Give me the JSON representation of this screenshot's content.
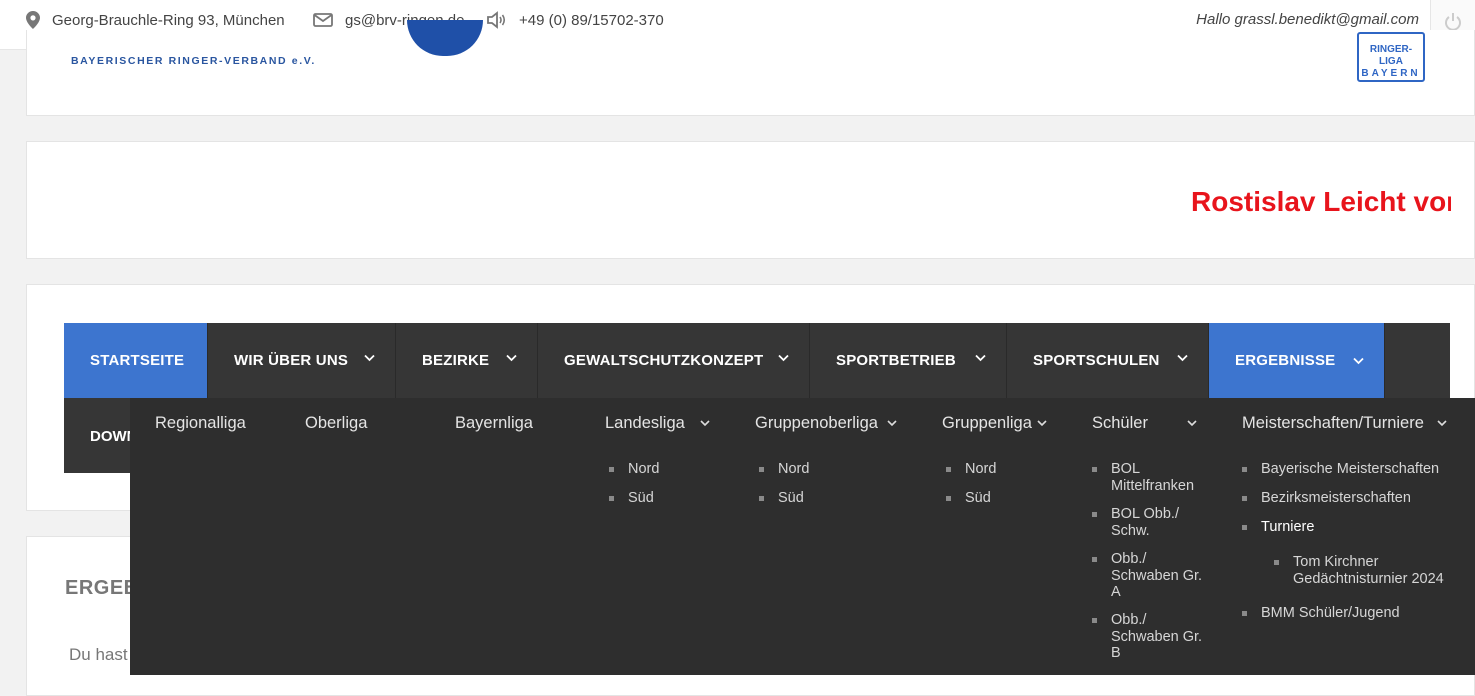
{
  "topbar": {
    "address": "Georg-Brauchle-Ring 93, München",
    "email": "gs@brv-ringen.de",
    "phone": "+49 (0) 89/15702-370",
    "greeting": "Hallo grassl.benedikt@gmail.com"
  },
  "header": {
    "logo_text": "BAYERISCHER RINGER-VERBAND e.V.",
    "liga_logo_line1": "RINGER-LIGA",
    "liga_logo_line2": "BAYERN"
  },
  "ticker": {
    "text": "Rostislav Leicht von"
  },
  "nav": {
    "items": [
      {
        "label": "STARTSEITE"
      },
      {
        "label": "WIR ÜBER UNS"
      },
      {
        "label": "BEZIRKE"
      },
      {
        "label": "GEWALTSCHUTZKONZEPT"
      },
      {
        "label": "SPORTBETRIEB"
      },
      {
        "label": "SPORTSCHULEN"
      },
      {
        "label": "ERGEBNISSE"
      }
    ],
    "row2_label": "DOWN"
  },
  "mega": {
    "columns": [
      {
        "head": "Regionalliga",
        "items": []
      },
      {
        "head": "Oberliga",
        "items": []
      },
      {
        "head": "Bayernliga",
        "items": []
      },
      {
        "head": "Landesliga",
        "items": [
          "Nord",
          "Süd"
        ]
      },
      {
        "head": "Gruppenoberliga",
        "items": [
          "Nord",
          "Süd"
        ]
      },
      {
        "head": "Gruppenliga",
        "items": [
          "Nord",
          "Süd"
        ]
      },
      {
        "head": "Schüler",
        "items": [
          "BOL Mittelfranken",
          "BOL Obb./ Schw.",
          "Obb./ Schwaben Gr. A",
          "Obb./ Schwaben Gr. B"
        ]
      },
      {
        "head": "Meisterschaften/Turniere",
        "items": [
          "Bayerische Meisterschaften",
          "Bezirksmeisterschaften",
          "Turniere",
          "BMM Schüler/Jugend"
        ],
        "subitems": [
          "Tom Kirchner Gedächtnisturnier 2024"
        ]
      }
    ]
  },
  "content": {
    "title": "ERGEB",
    "text": "Du hast"
  },
  "colors": {
    "accent": "#3d75cf",
    "nav_bg": "#363636",
    "dropdown_bg": "#2e2e2e",
    "ticker": "#e8141c"
  }
}
